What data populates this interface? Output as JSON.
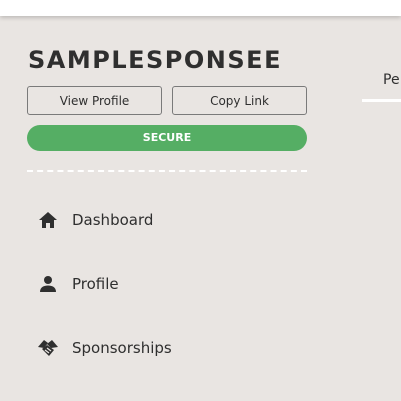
{
  "profile": {
    "username": "SAMPLESPONSEE",
    "view_profile_label": "View Profile",
    "copy_link_label": "Copy Link",
    "status_badge": "SECURE"
  },
  "colors": {
    "background": "#e9e5e2",
    "secure_badge": "#55ae64",
    "text": "#2f2f2f"
  },
  "nav": {
    "items": [
      {
        "label": "Dashboard",
        "icon": "home-icon"
      },
      {
        "label": "Profile",
        "icon": "person-icon"
      },
      {
        "label": "Sponsorships",
        "icon": "handshake-icon"
      }
    ]
  },
  "tabs": [
    {
      "label": "Pe"
    }
  ]
}
